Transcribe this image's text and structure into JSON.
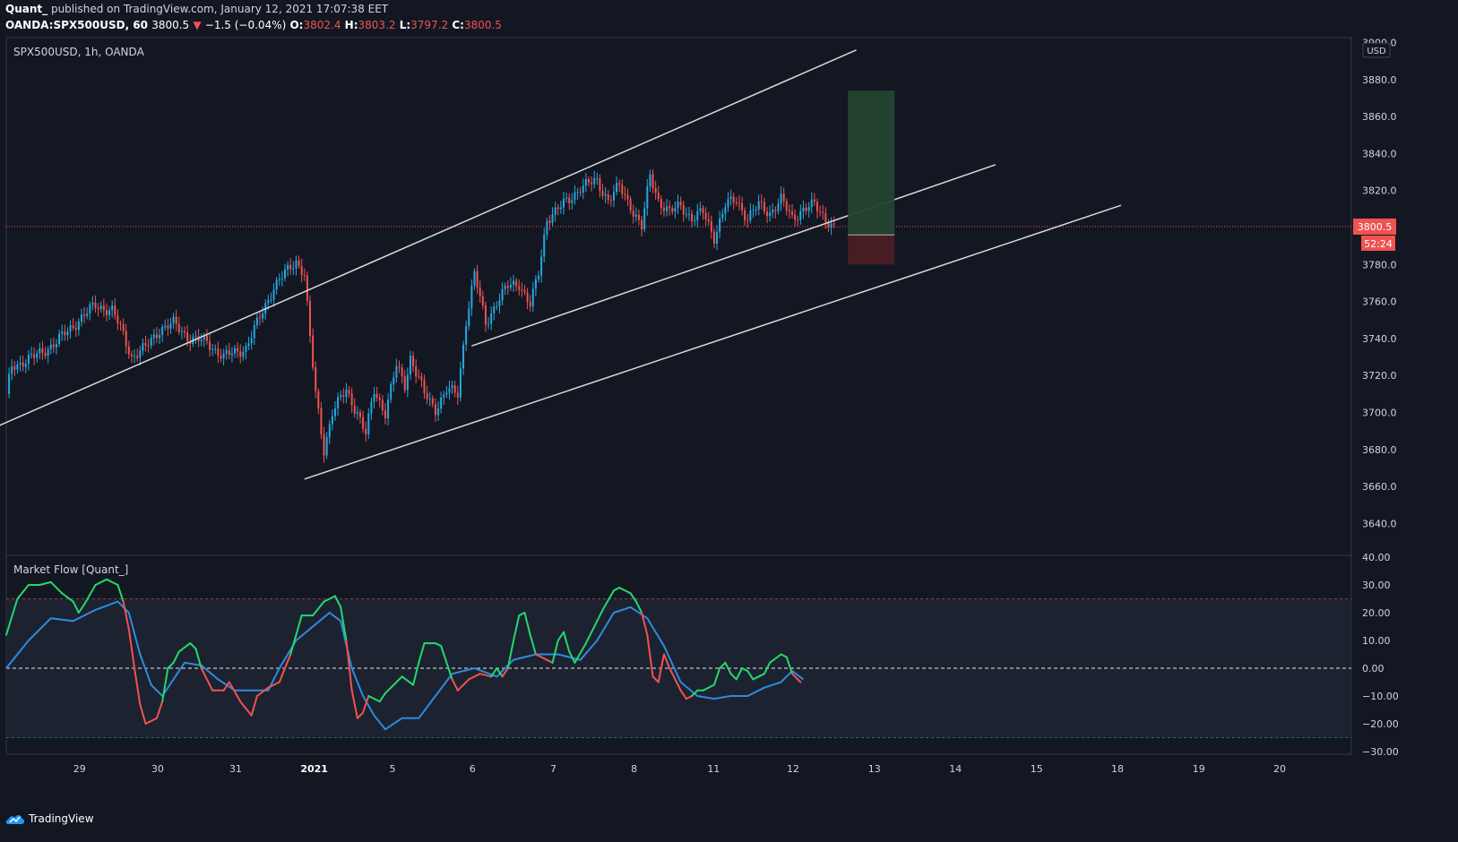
{
  "header": {
    "author": "Quant_",
    "published": "published on TradingView.com, January 12, 2021 17:07:38 EET",
    "symbol": "OANDA:SPX500USD, 60",
    "last": "3800.5",
    "change": "−1.5 (−0.04%)",
    "o_label": "O:",
    "o_value": "3802.4",
    "h_label": "H:",
    "h_value": "3803.2",
    "l_label": "L:",
    "l_value": "3797.2",
    "c_label": "C:",
    "c_value": "3800.5"
  },
  "footer": {
    "brand": "TradingView"
  },
  "colors": {
    "background": "#131722",
    "up": "#26a8e0",
    "down": "#ef5350",
    "flow_bull": "#22d96b",
    "flow_bear": "#ef5350",
    "flow_signal": "#2e8be0",
    "long_target": "#234430",
    "long_stop": "#4a1d24"
  },
  "chart_data": [
    {
      "type": "candlestick",
      "legend": "SPX500USD, 1h, OANDA",
      "currency": "USD",
      "last_price": "3800.5",
      "countdown": "52:24",
      "ylim": [
        3630,
        3900
      ],
      "y_ticks": [
        "3900.0",
        "3880.0",
        "3860.0",
        "3840.0",
        "3820.0",
        "3800.0",
        "3780.0",
        "3760.0",
        "3740.0",
        "3720.0",
        "3700.0",
        "3680.0",
        "3660.0",
        "3640.0"
      ],
      "x_ticks": [
        "29",
        "30",
        "31",
        "2021",
        "5",
        "6",
        "7",
        "8",
        "11",
        "12",
        "13",
        "14",
        "15",
        "18",
        "19",
        "20"
      ],
      "price_path": [
        [
          0,
          3710
        ],
        [
          2,
          3725
        ],
        [
          10,
          3730
        ],
        [
          18,
          3738
        ],
        [
          26,
          3750
        ],
        [
          32,
          3758
        ],
        [
          38,
          3755
        ],
        [
          42,
          3742
        ],
        [
          45,
          3730
        ],
        [
          50,
          3735
        ],
        [
          55,
          3745
        ],
        [
          60,
          3748
        ],
        [
          66,
          3740
        ],
        [
          72,
          3738
        ],
        [
          78,
          3730
        ],
        [
          86,
          3735
        ],
        [
          90,
          3748
        ],
        [
          96,
          3768
        ],
        [
          100,
          3775
        ],
        [
          104,
          3782
        ],
        [
          107,
          3775
        ],
        [
          109,
          3740
        ],
        [
          111,
          3710
        ],
        [
          114,
          3680
        ],
        [
          117,
          3700
        ],
        [
          122,
          3712
        ],
        [
          126,
          3700
        ],
        [
          129,
          3688
        ],
        [
          132,
          3712
        ],
        [
          136,
          3700
        ],
        [
          140,
          3725
        ],
        [
          143,
          3715
        ],
        [
          145,
          3730
        ],
        [
          150,
          3710
        ],
        [
          154,
          3702
        ],
        [
          158,
          3712
        ],
        [
          162,
          3710
        ],
        [
          165,
          3750
        ],
        [
          168,
          3775
        ],
        [
          172,
          3748
        ],
        [
          176,
          3760
        ],
        [
          180,
          3768
        ],
        [
          184,
          3770
        ],
        [
          188,
          3758
        ],
        [
          191,
          3775
        ],
        [
          194,
          3805
        ],
        [
          198,
          3810
        ],
        [
          202,
          3815
        ],
        [
          206,
          3822
        ],
        [
          212,
          3825
        ],
        [
          216,
          3815
        ],
        [
          220,
          3822
        ],
        [
          224,
          3812
        ],
        [
          228,
          3800
        ],
        [
          231,
          3828
        ],
        [
          234,
          3815
        ],
        [
          238,
          3808
        ],
        [
          242,
          3812
        ],
        [
          246,
          3805
        ],
        [
          250,
          3808
        ],
        [
          254,
          3795
        ],
        [
          258,
          3812
        ],
        [
          262,
          3815
        ],
        [
          266,
          3805
        ],
        [
          270,
          3812
        ],
        [
          274,
          3808
        ],
        [
          278,
          3815
        ],
        [
          282,
          3805
        ],
        [
          286,
          3810
        ],
        [
          290,
          3812
        ],
        [
          294,
          3805
        ],
        [
          297,
          3800
        ]
      ],
      "drawings": {
        "upper_channel_line": [
          [
            -4,
            3692
          ],
          [
            305,
            3896
          ]
        ],
        "mid_channel_line": [
          [
            167,
            3736
          ],
          [
            355,
            3834
          ]
        ],
        "lower_channel_line": [
          [
            107,
            3664
          ],
          [
            400,
            3812
          ]
        ],
        "long_position": {
          "entry": 3796,
          "target": 3874,
          "stop": 3780
        }
      }
    },
    {
      "type": "line",
      "legend": "Market Flow [Quant_]",
      "ylim": [
        -30,
        40
      ],
      "y_ticks": [
        "40.00",
        "30.00",
        "20.00",
        "10.00",
        "0.00",
        "−10.00",
        "−20.00",
        "−30.00"
      ],
      "levels": [
        25,
        0,
        -25
      ],
      "series": [
        {
          "values": [
            [
              0,
              12
            ],
            [
              4,
              25
            ],
            [
              8,
              30
            ],
            [
              12,
              30
            ],
            [
              16,
              31
            ],
            [
              20,
              27
            ],
            [
              24,
              24
            ],
            [
              26,
              20
            ],
            [
              28,
              23
            ],
            [
              32,
              30
            ],
            [
              36,
              32
            ],
            [
              40,
              30
            ],
            [
              42,
              24
            ],
            [
              44,
              14
            ],
            [
              46,
              0
            ],
            [
              48,
              -13
            ],
            [
              50,
              -20
            ],
            [
              54,
              -18
            ],
            [
              56,
              -12
            ],
            [
              58,
              0
            ],
            [
              60,
              2
            ],
            [
              62,
              6
            ],
            [
              66,
              9
            ],
            [
              68,
              7
            ],
            [
              70,
              0
            ],
            [
              74,
              -8
            ],
            [
              78,
              -8
            ],
            [
              80,
              -5
            ],
            [
              84,
              -12
            ],
            [
              88,
              -17
            ],
            [
              90,
              -10
            ],
            [
              94,
              -7
            ],
            [
              98,
              -5
            ],
            [
              102,
              5
            ],
            [
              106,
              19
            ],
            [
              110,
              19
            ],
            [
              114,
              24
            ],
            [
              118,
              26
            ],
            [
              120,
              22
            ],
            [
              122,
              10
            ],
            [
              124,
              -8
            ],
            [
              126,
              -18
            ],
            [
              128,
              -16
            ],
            [
              130,
              -10
            ],
            [
              134,
              -12
            ],
            [
              136,
              -9
            ],
            [
              140,
              -5
            ],
            [
              142,
              -3
            ],
            [
              146,
              -6
            ],
            [
              148,
              2
            ],
            [
              150,
              9
            ],
            [
              154,
              9
            ],
            [
              156,
              8
            ],
            [
              160,
              -4
            ],
            [
              162,
              -8
            ],
            [
              166,
              -4
            ],
            [
              170,
              -2
            ],
            [
              174,
              -3
            ],
            [
              176,
              0
            ],
            [
              178,
              -3
            ],
            [
              180,
              0
            ],
            [
              182,
              10
            ],
            [
              184,
              19
            ],
            [
              186,
              20
            ],
            [
              188,
              12
            ],
            [
              190,
              5
            ],
            [
              192,
              4
            ],
            [
              196,
              2
            ],
            [
              198,
              10
            ],
            [
              200,
              13
            ],
            [
              202,
              6
            ],
            [
              204,
              2
            ],
            [
              208,
              9
            ],
            [
              212,
              17
            ],
            [
              214,
              21
            ],
            [
              218,
              28
            ],
            [
              220,
              29
            ],
            [
              224,
              27
            ],
            [
              226,
              24
            ],
            [
              228,
              20
            ],
            [
              230,
              12
            ],
            [
              232,
              -3
            ],
            [
              234,
              -5
            ],
            [
              236,
              5
            ],
            [
              238,
              0
            ],
            [
              242,
              -8
            ],
            [
              244,
              -11
            ],
            [
              246,
              -10
            ],
            [
              248,
              -8
            ],
            [
              250,
              -8
            ],
            [
              254,
              -6
            ],
            [
              256,
              0
            ],
            [
              258,
              2
            ],
            [
              260,
              -2
            ],
            [
              262,
              -4
            ],
            [
              264,
              0
            ],
            [
              266,
              -1
            ],
            [
              268,
              -4
            ],
            [
              270,
              -3
            ],
            [
              272,
              -2
            ],
            [
              274,
              2
            ],
            [
              278,
              5
            ],
            [
              280,
              4
            ],
            [
              282,
              -2
            ],
            [
              285,
              -5
            ]
          ]
        },
        {
          "values": [
            [
              0,
              0
            ],
            [
              8,
              10
            ],
            [
              16,
              18
            ],
            [
              24,
              17
            ],
            [
              32,
              21
            ],
            [
              40,
              24
            ],
            [
              44,
              20
            ],
            [
              48,
              5
            ],
            [
              52,
              -6
            ],
            [
              56,
              -10
            ],
            [
              60,
              -4
            ],
            [
              64,
              2
            ],
            [
              70,
              1
            ],
            [
              76,
              -4
            ],
            [
              82,
              -8
            ],
            [
              88,
              -8
            ],
            [
              94,
              -8
            ],
            [
              98,
              0
            ],
            [
              104,
              10
            ],
            [
              110,
              15
            ],
            [
              116,
              20
            ],
            [
              120,
              17
            ],
            [
              124,
              0
            ],
            [
              128,
              -10
            ],
            [
              132,
              -17
            ],
            [
              136,
              -22
            ],
            [
              142,
              -18
            ],
            [
              148,
              -18
            ],
            [
              154,
              -10
            ],
            [
              160,
              -2
            ],
            [
              168,
              0
            ],
            [
              176,
              -3
            ],
            [
              182,
              3
            ],
            [
              190,
              5
            ],
            [
              198,
              5
            ],
            [
              206,
              3
            ],
            [
              212,
              10
            ],
            [
              218,
              20
            ],
            [
              224,
              22
            ],
            [
              230,
              18
            ],
            [
              236,
              8
            ],
            [
              242,
              -5
            ],
            [
              248,
              -10
            ],
            [
              254,
              -11
            ],
            [
              260,
              -10
            ],
            [
              266,
              -10
            ],
            [
              272,
              -7
            ],
            [
              278,
              -5
            ],
            [
              282,
              -1
            ],
            [
              286,
              -4
            ]
          ]
        }
      ]
    }
  ]
}
